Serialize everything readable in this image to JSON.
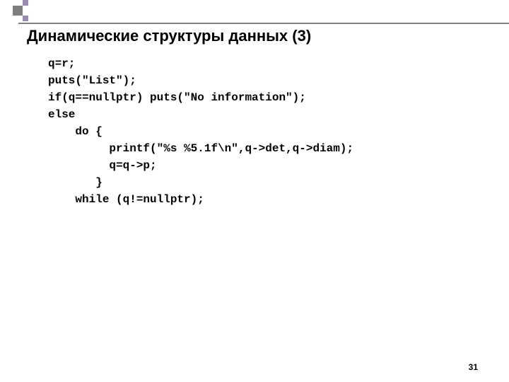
{
  "title": "Динамические структуры данных (3)",
  "code": "q=r;\nputs(\"List\");\nif(q==nullptr) puts(\"No information\");\nelse\n    do {\n         printf(\"%s %5.1f\\n\",q->det,q->diam);\n         q=q->p;\n       }\n    while (q!=nullptr);",
  "page_number": "31"
}
